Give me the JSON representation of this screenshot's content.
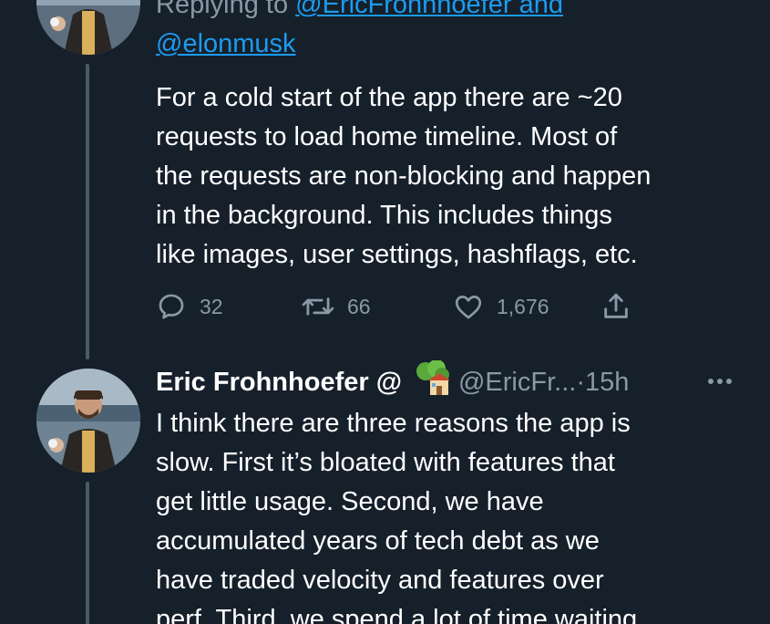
{
  "tweet1": {
    "replying_prefix": "Replying to ",
    "reply_mention_1": "@EricFrohnhoefer and",
    "reply_mention_2": "@elonmusk",
    "text_lines": [
      "For a cold start of the app there are ~20",
      "requests to load home timeline. Most of",
      "the requests are non-blocking and happen",
      "in the background. This includes things",
      "like images, user settings, hashflags, etc."
    ],
    "actions": {
      "reply_count": "32",
      "retweet_count": "66",
      "like_count": "1,676"
    }
  },
  "tweet2": {
    "author_name": "Eric Frohnhoefer @",
    "handle": "@EricFr...",
    "separator": " · ",
    "time": "15h",
    "text_lines": [
      "I think there are three reasons the app is",
      "slow. First it’s bloated with features that",
      "get little usage. Second, we have",
      "accumulated years of tech debt as we",
      "have traded velocity and features over",
      "perf. Third, we spend a lot of time waiting"
    ]
  },
  "colors": {
    "background": "#15202b",
    "text": "#ffffff",
    "secondary_text": "#8b98a5",
    "link": "#1d9bf0",
    "thread_line": "#4b5a68"
  },
  "icons": {
    "reply": "speech-bubble-icon",
    "retweet": "retweet-icon",
    "like": "heart-icon",
    "share": "share-icon",
    "more": "more-dots-icon",
    "emoji": "tree-house-emoji"
  }
}
